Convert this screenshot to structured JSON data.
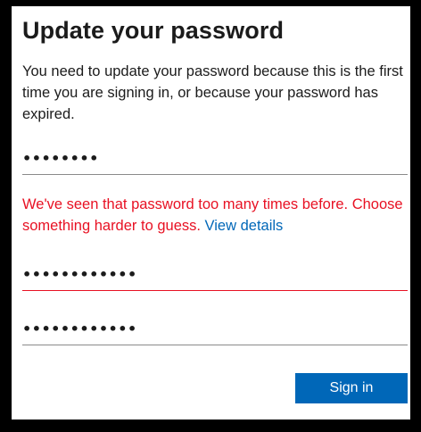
{
  "dialog": {
    "title": "Update your password",
    "description": "You need to update your password because this is the first time you are signing in, or because your password has expired."
  },
  "fields": {
    "current_password": {
      "value": "........"
    },
    "new_password": {
      "value": "............"
    },
    "confirm_password": {
      "value": "............"
    }
  },
  "error": {
    "message": "We've seen that password too many times before. Choose something harder to guess.",
    "link_label": "View details"
  },
  "actions": {
    "sign_in_label": "Sign in"
  },
  "colors": {
    "accent": "#0067b8",
    "error": "#e81123",
    "frame": "#000000"
  }
}
